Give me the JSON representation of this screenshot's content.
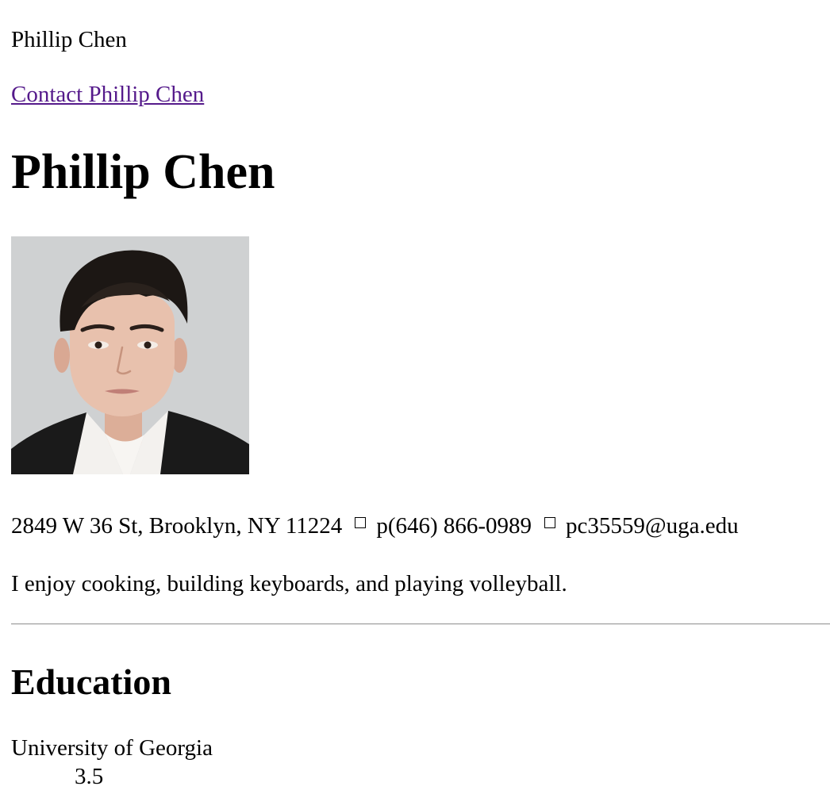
{
  "header": {
    "site_name": "Phillip Chen",
    "contact_link": "Contact Phillip Chen"
  },
  "profile": {
    "name": "Phillip Chen",
    "photo_icon": "portrait-photo",
    "address": "2849 W 36 St, Brooklyn, NY 11224",
    "phone": "p(646) 866-0989",
    "email": "pc35559@uga.edu",
    "separator_icon": "box-separator",
    "bio": "I enjoy cooking, building keyboards, and playing volleyball."
  },
  "education": {
    "heading": "Education",
    "school": "University of Georgia",
    "gpa": "3.5"
  },
  "colors": {
    "link_visited": "#551a8b",
    "photo_background": "#d3d4d6",
    "jacket": "#1a1a1a",
    "shirt": "#f3f1ee"
  }
}
